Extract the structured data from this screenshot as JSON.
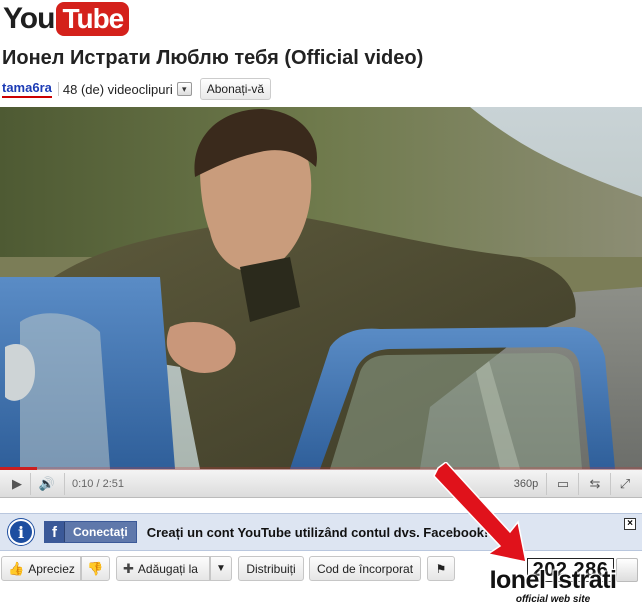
{
  "logo": {
    "you": "You",
    "tube": "Tube"
  },
  "video": {
    "title": "Ионел Истрати Люблю тебя (Official video)",
    "channel": "tama6ra",
    "video_count": "48 (de) videoclipuri",
    "subscribe_label": "Abonați-vă"
  },
  "player": {
    "time": "0:10 / 2:51",
    "quality": "360p",
    "progress_fraction": 0.058
  },
  "facebook_bar": {
    "connect_label": "Conectați",
    "message": "Creați un cont YouTube utilizând contul dvs. Facebook!",
    "close_symbol": "×"
  },
  "actions": {
    "like_label": "Apreciez",
    "add_label": "Adăugați la",
    "share_label": "Distribuiți",
    "embed_label": "Cod de încorporat"
  },
  "views": "202 286",
  "watermark": {
    "name": "Ionel Istrati",
    "subtitle": "official web site"
  },
  "colors": {
    "brand_red": "#d4211b",
    "link_blue": "#1c3bb5",
    "facebook_blue": "#3b5998",
    "arrow_red": "#e0121b"
  }
}
